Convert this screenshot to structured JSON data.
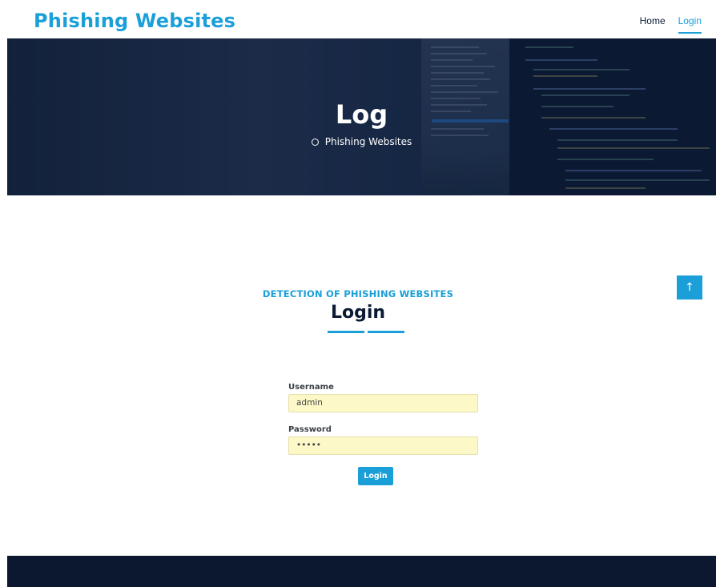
{
  "header": {
    "brand": "Phishing Websites",
    "nav": [
      {
        "label": "Home",
        "active": false
      },
      {
        "label": "Login",
        "active": true
      }
    ]
  },
  "hero": {
    "title": "Log",
    "breadcrumb": "Phishing Websites"
  },
  "section": {
    "subtitle": "DETECTION OF PHISHING WEBSITES",
    "title": "Login"
  },
  "form": {
    "username_label": "Username",
    "username_value": "admin",
    "password_label": "Password",
    "password_value": "admin",
    "submit_label": "Login"
  },
  "scroll_top": {
    "icon": "arrow-up-icon",
    "glyph": "↑"
  },
  "colors": {
    "accent": "#1a9fd8",
    "dark": "#0b1a33",
    "input_bg": "#fdf8c8",
    "footer_bg": "#0b1830"
  }
}
